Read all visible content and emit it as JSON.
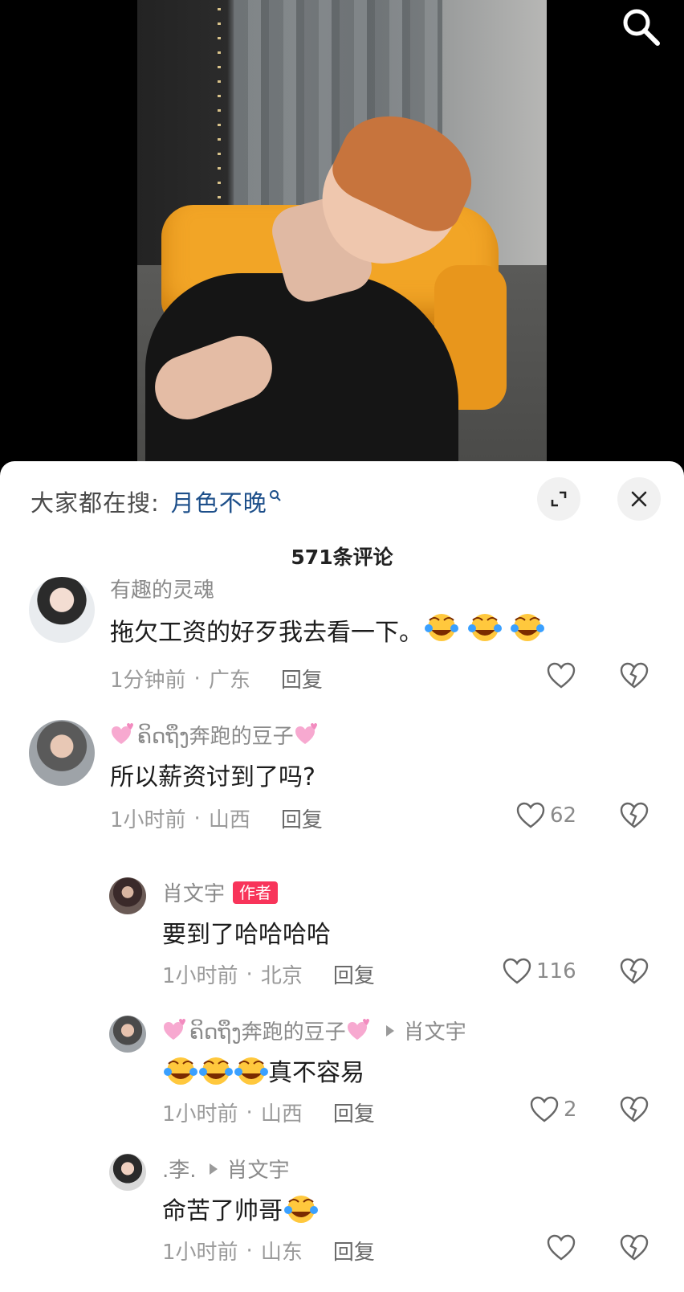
{
  "header": {
    "search_icon": "search-icon"
  },
  "sheet": {
    "trending_prefix": "大家都在搜:",
    "trending_term": "月色不晚",
    "comment_count": "571条评论",
    "expand_icon": "expand-icon",
    "close_icon": "close-icon"
  },
  "comments": [
    {
      "username": "有趣的灵魂",
      "text": "拖欠工资的好歹我去看一下。",
      "emoji_count": 3,
      "time": "1分钟前",
      "location": "广东",
      "reply_label": "回复",
      "likes": ""
    },
    {
      "username": "ຄິດຖຶງ奔跑的豆子",
      "text": "所以薪资讨到了吗?",
      "time": "1小时前",
      "location": "山西",
      "reply_label": "回复",
      "likes": "62"
    }
  ],
  "replies": [
    {
      "username": "肖文宇",
      "badge": "作者",
      "text": "要到了哈哈哈哈",
      "time": "1小时前",
      "location": "北京",
      "reply_label": "回复",
      "likes": "116"
    },
    {
      "username": "ຄິດຖຶງ奔跑的豆子",
      "reply_to": "肖文宇",
      "text": "真不容易",
      "emoji_count": 3,
      "time": "1小时前",
      "location": "山西",
      "reply_label": "回复",
      "likes": "2"
    },
    {
      "username": ".李.",
      "reply_to": "肖文宇",
      "text": "命苦了帅哥",
      "emoji_count": 1,
      "time": "1小时前",
      "location": "山东",
      "reply_label": "回复",
      "likes": ""
    }
  ],
  "separator": "·",
  "colors": {
    "accent_blue": "#1d4f8a",
    "author_badge": "#f8345a",
    "secondary_text": "#8a8a8a"
  }
}
